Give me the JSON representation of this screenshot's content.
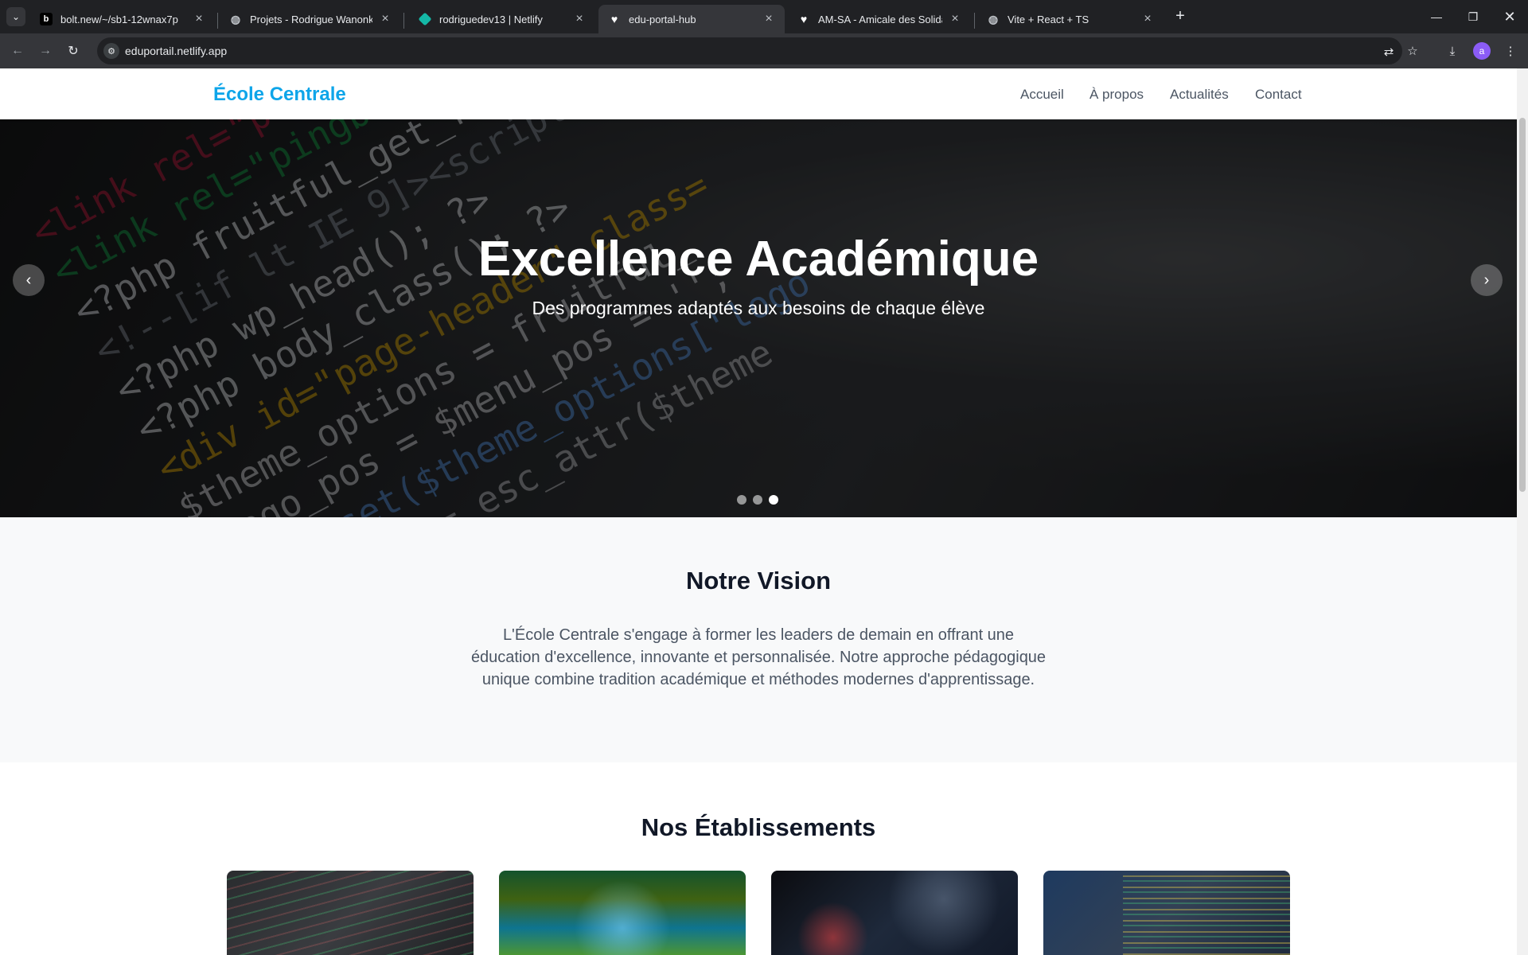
{
  "browser": {
    "tabs": [
      {
        "title": "bolt.new/~/sb1-12wnax7p",
        "icon": "bolt-icon"
      },
      {
        "title": "Projets - Rodrigue Wanonkou",
        "icon": "globe-icon"
      },
      {
        "title": "rodriguedev13 | Netlify",
        "icon": "netlify-icon"
      },
      {
        "title": "edu-portal-hub",
        "icon": "heart-icon"
      },
      {
        "title": "AM-SA - Amicale des Solidaires",
        "icon": "heart-icon"
      },
      {
        "title": "Vite + React + TS",
        "icon": "globe-icon"
      }
    ],
    "active_tab": 3,
    "url": "eduportail.netlify.app",
    "profile_initial": "a"
  },
  "site": {
    "brand": "École Centrale",
    "nav": [
      "Accueil",
      "À propos",
      "Actualités",
      "Contact"
    ]
  },
  "hero": {
    "title": "Excellence Académique",
    "subtitle": "Des programmes adaptés aux besoins de chaque élève",
    "slide_count": 3,
    "active_slide": 3
  },
  "vision": {
    "title": "Notre Vision",
    "text": "L'École Centrale s'engage à former les leaders de demain en offrant une éducation d'excellence, innovante et personnalisée. Notre approche pédagogique unique combine tradition académique et méthodes modernes d'apprentissage."
  },
  "establishments": {
    "title": "Nos Établissements"
  },
  "colors": {
    "brand": "#0ea5e9",
    "chrome_bg": "#202124",
    "chrome_toolbar": "#35363a"
  }
}
